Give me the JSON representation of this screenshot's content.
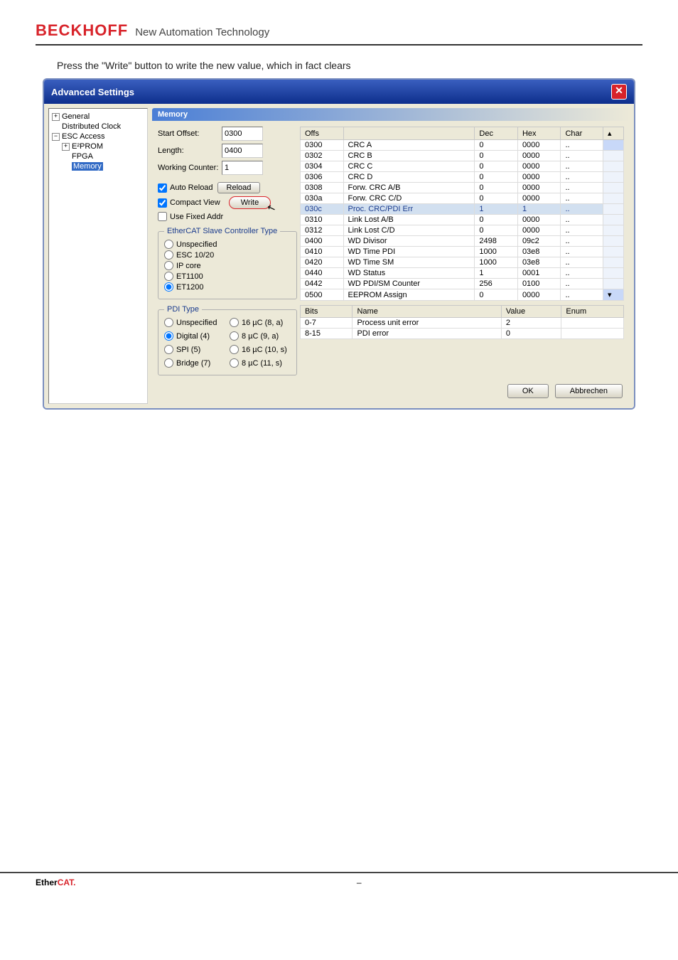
{
  "header": {
    "logo": "BECKHOFF",
    "sub": "New Automation Technology"
  },
  "instruction": "Press the \"Write\" button to write the new value, which in fact clears",
  "dialog": {
    "title": "Advanced Settings"
  },
  "tree": {
    "items": [
      {
        "label": "General",
        "indent": 0,
        "exp": "+"
      },
      {
        "label": "Distributed Clock",
        "indent": 1
      },
      {
        "label": "ESC Access",
        "indent": 0,
        "exp": "−"
      },
      {
        "label": "E²PROM",
        "indent": 1,
        "exp": "+"
      },
      {
        "label": "FPGA",
        "indent": 2
      },
      {
        "label": "Memory",
        "indent": 2,
        "selected": true
      }
    ]
  },
  "section": {
    "title": "Memory"
  },
  "fields": {
    "start_offset_label": "Start Offset:",
    "start_offset_value": "0300",
    "length_label": "Length:",
    "length_value": "0400",
    "working_counter_label": "Working Counter:",
    "working_counter_value": "1",
    "auto_reload_label": "Auto Reload",
    "compact_view_label": "Compact View",
    "use_fixed_addr_label": "Use Fixed Addr",
    "reload_btn": "Reload",
    "write_btn": "Write"
  },
  "esc_group": {
    "legend": "EtherCAT Slave Controller Type",
    "opts": [
      "Unspecified",
      "ESC 10/20",
      "IP core",
      "ET1100",
      "ET1200"
    ]
  },
  "pdi_group": {
    "legend": "PDI Type",
    "opts": [
      "Unspecified",
      "16 µC (8, a)",
      "Digital (4)",
      "8 µC (9, a)",
      "SPI (5)",
      "16 µC (10, s)",
      "Bridge (7)",
      "8 µC (11, s)"
    ]
  },
  "table1": {
    "headers": [
      "Offs",
      "",
      "Dec",
      "Hex",
      "Char"
    ],
    "rows": [
      [
        "0300",
        "CRC A",
        "0",
        "0000",
        ".."
      ],
      [
        "0302",
        "CRC B",
        "0",
        "0000",
        ".."
      ],
      [
        "0304",
        "CRC C",
        "0",
        "0000",
        ".."
      ],
      [
        "0306",
        "CRC D",
        "0",
        "0000",
        ".."
      ],
      [
        "0308",
        "Forw. CRC A/B",
        "0",
        "0000",
        ".."
      ],
      [
        "030a",
        "Forw. CRC C/D",
        "0",
        "0000",
        ".."
      ],
      [
        "030c",
        "Proc. CRC/PDI Err",
        "1",
        "1",
        "..",
        true
      ],
      [
        "0310",
        "Link Lost A/B",
        "0",
        "0000",
        ".."
      ],
      [
        "0312",
        "Link Lost C/D",
        "0",
        "0000",
        ".."
      ],
      [
        "0400",
        "WD Divisor",
        "2498",
        "09c2",
        ".."
      ],
      [
        "0410",
        "WD Time PDI",
        "1000",
        "03e8",
        ".."
      ],
      [
        "0420",
        "WD Time SM",
        "1000",
        "03e8",
        ".."
      ],
      [
        "0440",
        "WD Status",
        "1",
        "0001",
        ".."
      ],
      [
        "0442",
        "WD PDI/SM Counter",
        "256",
        "0100",
        ".."
      ],
      [
        "0500",
        "EEPROM Assign",
        "0",
        "0000",
        ".."
      ]
    ]
  },
  "table2": {
    "headers": [
      "Bits",
      "Name",
      "Value",
      "Enum"
    ],
    "rows": [
      [
        "0-7",
        "Process unit error",
        "2",
        ""
      ],
      [
        "8-15",
        "PDI error",
        "0",
        ""
      ]
    ]
  },
  "buttons": {
    "ok": "OK",
    "cancel": "Abbrechen"
  },
  "footer": {
    "logo1": "Ether",
    "logo2": "CAT.",
    "dash": "–"
  }
}
